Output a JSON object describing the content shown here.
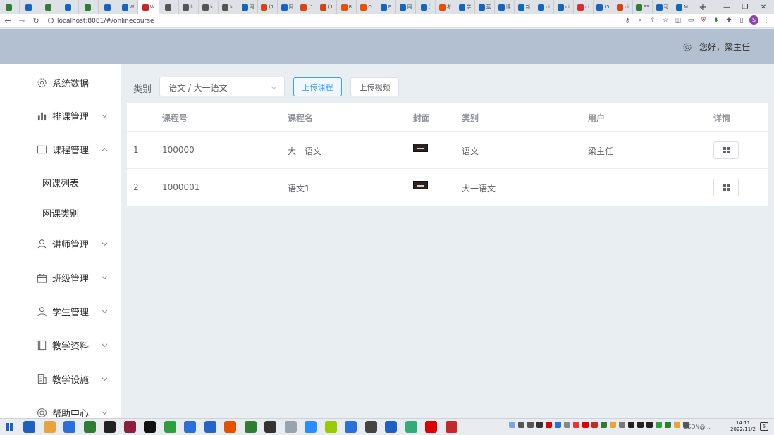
{
  "browser": {
    "url": "localhost:8081/#/onlinecourse",
    "tab_favicon_colors": [
      "#2e7d32",
      "#1565c0",
      "#2e7d32",
      "#1565c0",
      "#2e7d32",
      "#1565c0",
      "#1565c0",
      "#c62828",
      "#555555",
      "#555555",
      "#555555",
      "#555555",
      "#1565c0",
      "#d84315",
      "#1565c0",
      "#d84315",
      "#d84315",
      "#e65100",
      "#e65100",
      "#1565c0",
      "#1565c0",
      "#1565c0",
      "#e65100",
      "#1565c0",
      "#1565c0",
      "#1565c0",
      "#1565c0",
      "#1565c0",
      "#1565c0",
      "#d32f2f",
      "#1565c0",
      "#d84315",
      "#2e7d32",
      "#1565c0",
      "#1565c0"
    ],
    "tab_labels": [
      "",
      "",
      "",
      "",
      "",
      "",
      "W",
      "W",
      "",
      "lc",
      "lc",
      "lc",
      "网",
      "(1",
      "网",
      "(1",
      "(1",
      "R",
      "O",
      "E",
      "网",
      "(",
      "考",
      "学",
      "蓝",
      "博",
      "新",
      "ci",
      "ci",
      "ci",
      "(5",
      "ci",
      "ES",
      "可",
      "M"
    ],
    "window_buttons": [
      "minimize-icon",
      "maximize-icon",
      "close-icon"
    ]
  },
  "header": {
    "greeting": "您好，梁主任"
  },
  "sidebar": {
    "items": [
      {
        "label": "系统数据",
        "icon": "gear-icon",
        "has_arrow": false
      },
      {
        "label": "排课管理",
        "icon": "bar-chart-icon",
        "has_arrow": true,
        "expanded": false
      },
      {
        "label": "课程管理",
        "icon": "book-icon",
        "has_arrow": true,
        "expanded": true
      },
      {
        "label": "讲师管理",
        "icon": "user-icon",
        "has_arrow": true,
        "expanded": false
      },
      {
        "label": "班级管理",
        "icon": "gift-icon",
        "has_arrow": true,
        "expanded": false
      },
      {
        "label": "学生管理",
        "icon": "user-icon",
        "has_arrow": true,
        "expanded": false
      },
      {
        "label": "教学资料",
        "icon": "notebook-icon",
        "has_arrow": true,
        "expanded": false
      },
      {
        "label": "教学设施",
        "icon": "building-icon",
        "has_arrow": true,
        "expanded": false
      },
      {
        "label": "帮助中心",
        "icon": "help-icon",
        "has_arrow": true,
        "expanded": false
      }
    ],
    "sub_items": [
      "网课列表",
      "网课类别"
    ]
  },
  "toolbar": {
    "filter_label": "类别",
    "select_value": "语文 / 大一语文",
    "upload_course_label": "上传课程",
    "upload_video_label": "上传视频"
  },
  "table": {
    "headers": [
      "",
      "课程号",
      "课程名",
      "封面",
      "类别",
      "用户",
      "详情"
    ],
    "rows": [
      {
        "index": "1",
        "course_no": "100000",
        "course_name": "大一语文",
        "category": "语文",
        "user": "梁主任"
      },
      {
        "index": "2",
        "course_no": "1000001",
        "course_name": "语文1",
        "category": "大一语文",
        "user": ""
      }
    ]
  },
  "taskbar": {
    "app_colors": [
      "#1f5fbf",
      "#e8a33b",
      "#2b6fdc",
      "#2e7d32",
      "#222222",
      "#8e1e3e",
      "#111111",
      "#2e9e3e",
      "#2b6fdc",
      "#2563c9",
      "#e65100",
      "#2e7d32",
      "#333333",
      "#9aa3ad",
      "#2b8cff",
      "#9c0",
      "#2b6fdc",
      "#444",
      "#1f5fbf",
      "#3a7",
      "#d00",
      "#c62828"
    ],
    "tray_text": "CSDN@...",
    "time": "14:11",
    "date": "2022/11/2",
    "notif_count": "5"
  },
  "colors": {
    "header_bg": "#b3c0d1",
    "main_bg": "#e9eef3",
    "primary": "#409eff"
  }
}
